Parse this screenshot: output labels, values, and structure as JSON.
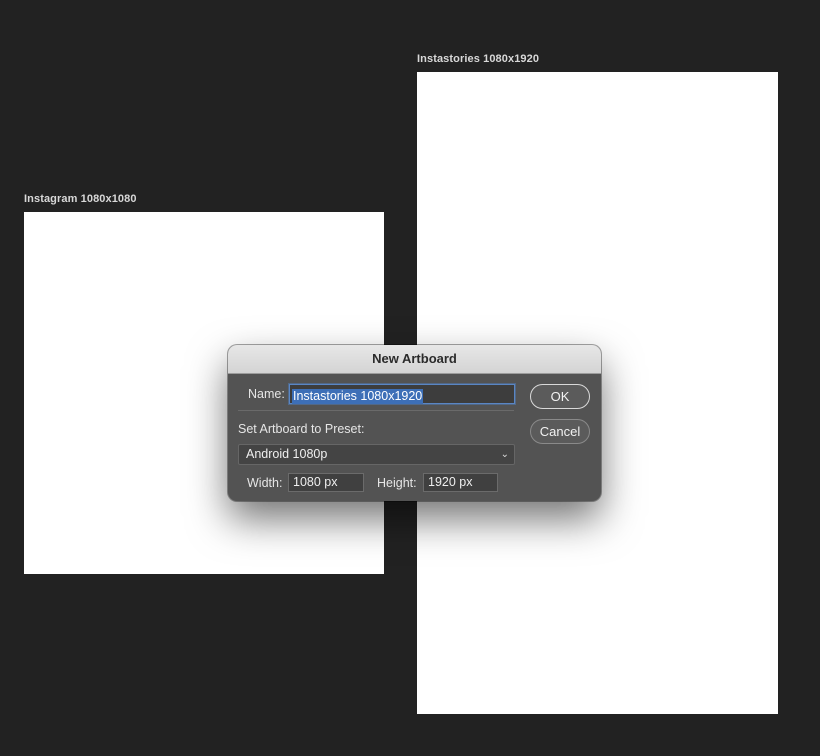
{
  "canvas": {
    "background": "#222222",
    "artboards": [
      {
        "label": "Instagram 1080x1080"
      },
      {
        "label": "Instastories 1080x1920"
      }
    ]
  },
  "dialog": {
    "title": "New Artboard",
    "name_label": "Name:",
    "name_value": "Instastories 1080x1920",
    "preset_label": "Set Artboard to Preset:",
    "preset_value": "Android 1080p",
    "width_label": "Width:",
    "width_value": "1080 px",
    "height_label": "Height:",
    "height_value": "1920 px",
    "ok_label": "OK",
    "cancel_label": "Cancel",
    "chevron_icon": "chevron-down-icon",
    "selection_color": "#3d6fb7"
  }
}
